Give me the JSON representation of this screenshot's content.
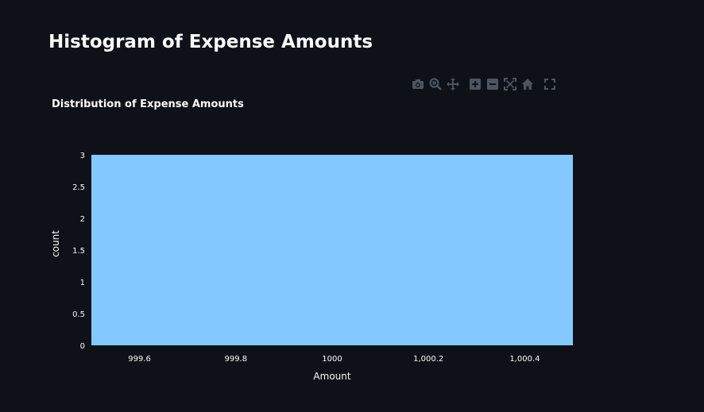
{
  "page": {
    "title": "Histogram of Expense Amounts"
  },
  "modebar": {
    "buttons": [
      {
        "name": "download-plot-button",
        "icon": "camera-icon"
      },
      {
        "name": "zoom-button",
        "icon": "zoom-icon"
      },
      {
        "name": "pan-button",
        "icon": "pan-icon"
      },
      {
        "name": "zoom-in-button",
        "icon": "zoom-in-icon"
      },
      {
        "name": "zoom-out-button",
        "icon": "zoom-out-icon"
      },
      {
        "name": "autoscale-button",
        "icon": "autoscale-icon"
      },
      {
        "name": "reset-axes-button",
        "icon": "home-icon"
      },
      {
        "name": "fullscreen-button",
        "icon": "fullscreen-icon"
      }
    ],
    "icon_color": "#4e5561"
  },
  "chart_data": {
    "type": "bar",
    "title": "Distribution of Expense Amounts",
    "xlabel": "Amount",
    "ylabel": "count",
    "bins": [
      {
        "x0": 999.5,
        "x1": 1000.5,
        "count": 3
      }
    ],
    "xlim": [
      999.5,
      1000.5
    ],
    "ylim": [
      0,
      3
    ],
    "xticks": [
      999.6,
      999.8,
      1000,
      1000.2,
      1000.4
    ],
    "xtick_labels": [
      "999.6",
      "999.8",
      "1000",
      "1,000.2",
      "1,000.4"
    ],
    "yticks": [
      0,
      0.5,
      1,
      1.5,
      2,
      2.5,
      3
    ],
    "ytick_labels": [
      "0",
      "0.5",
      "1",
      "1.5",
      "2",
      "2.5",
      "3"
    ],
    "grid": false,
    "bar_color": "#83c9ff",
    "background": "#0e1117",
    "text_color": "#fafafa"
  }
}
